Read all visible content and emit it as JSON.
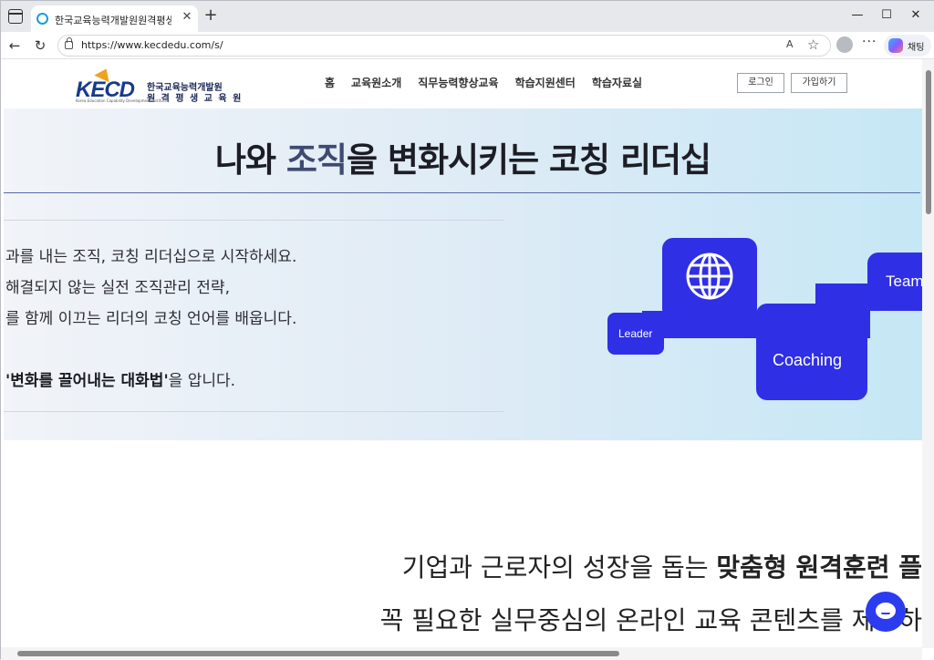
{
  "browser": {
    "tab_title": "한국교육능력개발원원격평생교육원",
    "tab_close": "✕",
    "new_tab": "+",
    "window_controls": {
      "minimize": "—",
      "maximize": "☐",
      "close": "✕"
    },
    "nav": {
      "back": "←",
      "refresh": "↻"
    },
    "url": "https://www.kecdedu.com/s/",
    "read_aloud": "A",
    "favorite": "☆",
    "more": "···",
    "copilot_label": "채팅"
  },
  "header": {
    "logo": {
      "wordmark": "KECD",
      "line1": "한국교육능력개발원",
      "line2": "원 격 평 생 교 육 원",
      "subtitle": "Korea Education Capability Development Institute"
    },
    "nav_items": [
      "홈",
      "교육원소개",
      "직무능력향상교육",
      "학습지원센터",
      "학습자료실"
    ],
    "login_label": "로그인",
    "signup_label": "가입하기"
  },
  "hero": {
    "title_part1": "나와 ",
    "title_accent": "조직",
    "title_part2": "을 변화시키는 코칭 리더십",
    "line1": "과를 내는 조직, 코칭 리더십으로 시작하세요.",
    "line2": "해결되지 않는 실전 조직관리 전략,",
    "line3": "를 함께 이끄는 리더의 코칭 언어를 배웁니다.",
    "line4_bold": "'변화를 끌어내는 대화법'",
    "line4_rest": "을 압니다.",
    "tiles": {
      "leader": "Leader",
      "coaching": "Coaching",
      "team": "Team"
    }
  },
  "section": {
    "line1_plain": "기업과 근로자의 성장을 돕는 ",
    "line1_bold": "맞춤형 원격훈련 플",
    "line2_plain": "꼭 필요한 실무중심의 온라인 교육 콘텐츠를 제공하"
  },
  "colors": {
    "accent_blue": "#2f2fe6",
    "navy": "#163a8c",
    "logo_orange": "#f0a21a"
  }
}
